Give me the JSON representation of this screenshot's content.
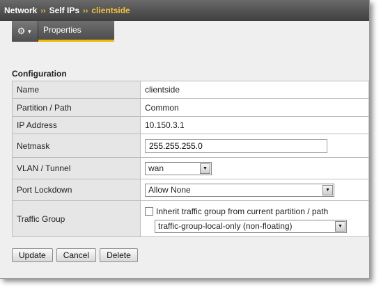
{
  "breadcrumb": {
    "items": [
      "Network",
      "Self IPs",
      "clientside"
    ],
    "separator": "››"
  },
  "tabs": {
    "gear_icon": "gear-icon",
    "properties_label": "Properties"
  },
  "section": {
    "title": "Configuration"
  },
  "fields": {
    "name": {
      "label": "Name",
      "value": "clientside"
    },
    "partition": {
      "label": "Partition / Path",
      "value": "Common"
    },
    "ip_address": {
      "label": "IP Address",
      "value": "10.150.3.1"
    },
    "netmask": {
      "label": "Netmask",
      "value": "255.255.255.0"
    },
    "vlan": {
      "label": "VLAN / Tunnel",
      "value": "wan"
    },
    "port_lockdown": {
      "label": "Port Lockdown",
      "value": "Allow None"
    },
    "traffic_group": {
      "label": "Traffic Group",
      "inherit_label": "Inherit traffic group from current partition / path",
      "inherit_checked": false,
      "value": "traffic-group-local-only (non-floating)"
    }
  },
  "buttons": {
    "update": "Update",
    "cancel": "Cancel",
    "delete": "Delete"
  },
  "colors": {
    "accent": "#f0c040",
    "tab_underline": "#f0b800",
    "header_bg": "#4f4f4f"
  }
}
